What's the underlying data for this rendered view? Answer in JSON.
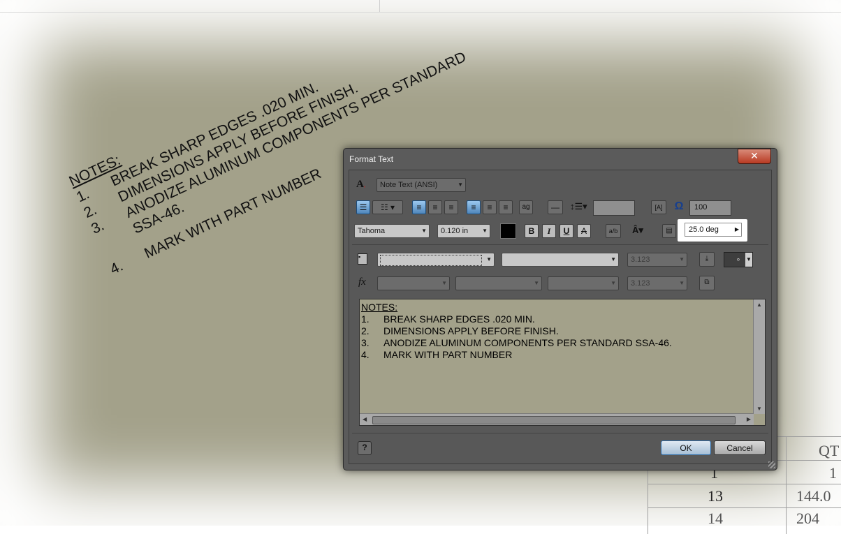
{
  "drawing": {
    "notes_title": "NOTES:",
    "notes": [
      {
        "num": "1.",
        "text": "BREAK SHARP EDGES .020 MIN."
      },
      {
        "num": "2.",
        "text": "DIMENSIONS APPLY BEFORE FINISH."
      },
      {
        "num": "3.",
        "text": "ANODIZE ALUMINUM COMPONENTS PER STANDARD"
      },
      {
        "num": "",
        "text": "SSA-46."
      },
      {
        "num": "4.",
        "text": "MARK WITH PART NUMBER"
      }
    ],
    "table": {
      "header_qty": "QT",
      "rows": [
        {
          "item": "1",
          "qty": "1"
        },
        {
          "item": "13",
          "qty": "144.0"
        },
        {
          "item": "14",
          "qty": "204"
        }
      ]
    }
  },
  "dialog": {
    "title": "Format Text",
    "close_label": "✕",
    "style_select": "Note Text (ANSI)",
    "stretch_value": "100",
    "font_select": "Tahoma",
    "size_select": "0.120 in",
    "bold_label": "B",
    "italic_label": "I",
    "underline_label": "U",
    "strike_label": "A",
    "rotation_value": "25.0 deg",
    "param_value_1": "3.123",
    "param_value_2": "3.123",
    "precision_label": "∘",
    "fx_label": "fx",
    "editor_title": "NOTES:",
    "editor_lines": [
      {
        "num": "1.",
        "text": "BREAK SHARP EDGES .020 MIN."
      },
      {
        "num": "2.",
        "text": "DIMENSIONS APPLY BEFORE FINISH."
      },
      {
        "num": "3.",
        "text": "ANODIZE ALUMINUM COMPONENTS PER STANDARD SSA-46."
      },
      {
        "num": "4.",
        "text": "MARK WITH PART NUMBER"
      }
    ],
    "ok_label": "OK",
    "cancel_label": "Cancel",
    "help_label": "?",
    "colors": {
      "canvas": "#a3a18a",
      "dialog_bg": "#5b5b5b",
      "close_red": "#b83a22",
      "active_blue": "#4f86bb"
    }
  }
}
